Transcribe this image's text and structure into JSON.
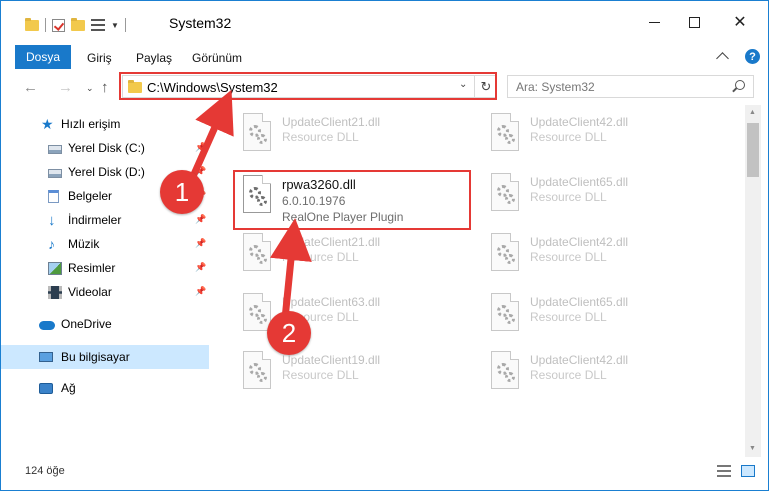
{
  "window": {
    "title": "System32"
  },
  "ribbon": {
    "tabs": [
      "Dosya",
      "Giriş",
      "Paylaş",
      "Görünüm"
    ]
  },
  "address": {
    "path": "C:\\Windows\\System32"
  },
  "search": {
    "placeholder": "Ara: System32"
  },
  "sidebar": {
    "items": [
      {
        "label": "Hızlı erişim",
        "icon": "star-icon"
      },
      {
        "label": "Yerel Disk (C:)",
        "icon": "drive-icon"
      },
      {
        "label": "Yerel Disk (D:)",
        "icon": "drive-icon"
      },
      {
        "label": "Belgeler",
        "icon": "document-icon"
      },
      {
        "label": "İndirmeler",
        "icon": "download-icon"
      },
      {
        "label": "Müzik",
        "icon": "music-icon"
      },
      {
        "label": "Resimler",
        "icon": "pictures-icon"
      },
      {
        "label": "Videolar",
        "icon": "video-icon"
      },
      {
        "label": "OneDrive",
        "icon": "cloud-icon"
      },
      {
        "label": "Bu bilgisayar",
        "icon": "computer-icon"
      },
      {
        "label": "Ağ",
        "icon": "network-icon"
      }
    ]
  },
  "files": {
    "left": [
      {
        "name": "UpdateClient21.dll",
        "desc": "Resource DLL"
      },
      {
        "name": "UpdateClient21.dll",
        "desc": "Resource DLL"
      },
      {
        "name": "UpdateClient63.dll",
        "desc": "Resource DLL"
      },
      {
        "name": "UpdateClient19.dll",
        "desc": "Resource DLL"
      }
    ],
    "right": [
      {
        "name": "UpdateClient42.dll",
        "desc": "Resource DLL"
      },
      {
        "name": "UpdateClient65.dll",
        "desc": "Resource DLL"
      },
      {
        "name": "UpdateClient42.dll",
        "desc": "Resource DLL"
      },
      {
        "name": "UpdateClient65.dll",
        "desc": "Resource DLL"
      },
      {
        "name": "UpdateClient42.dll",
        "desc": "Resource DLL"
      }
    ],
    "active": {
      "name": "rpwa3260.dll",
      "version": "6.0.10.1976",
      "desc": "RealOne Player Plugin"
    }
  },
  "status": {
    "count": "124 öğe"
  },
  "annotations": {
    "step1": "1",
    "step2": "2",
    "color": "#e53935"
  }
}
